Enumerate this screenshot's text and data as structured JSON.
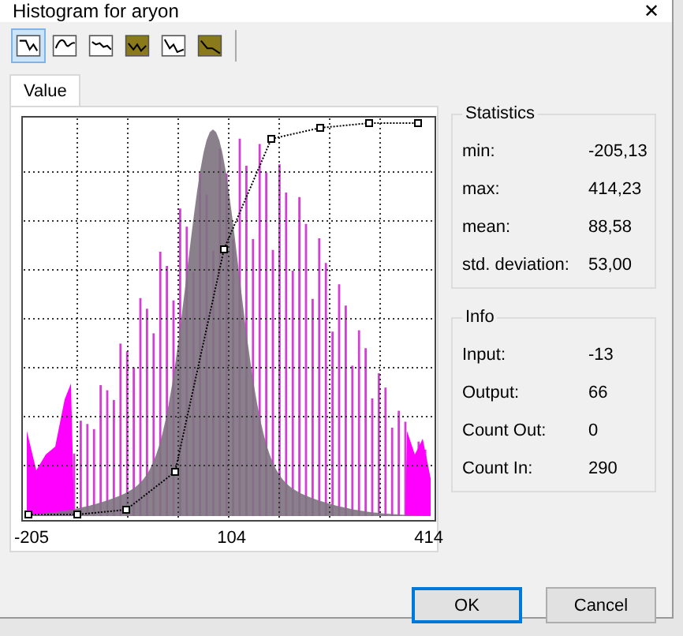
{
  "window": {
    "title": "Histogram for aryon",
    "close": "✕"
  },
  "toolbar": [
    {
      "selected": true
    },
    {
      "selected": false
    },
    {
      "selected": false
    },
    {
      "selected": false
    },
    {
      "selected": false
    },
    {
      "selected": false
    }
  ],
  "tabs": [
    {
      "label": "Value",
      "selected": true
    }
  ],
  "axis_labels": [
    "-205",
    "104",
    "414"
  ],
  "statistics": {
    "title": "Statistics",
    "rows": [
      {
        "label": "min:",
        "value": "-205,13"
      },
      {
        "label": "max:",
        "value": "414,23"
      },
      {
        "label": "mean:",
        "value": "88,58"
      },
      {
        "label": "std. deviation:",
        "value": "53,00"
      }
    ]
  },
  "info": {
    "title": "Info",
    "rows": [
      {
        "label": "Input:",
        "value": "-13"
      },
      {
        "label": "Output:",
        "value": "66"
      },
      {
        "label": "Count Out:",
        "value": "0"
      },
      {
        "label": "Count In:",
        "value": "290"
      }
    ]
  },
  "buttons": [
    {
      "label": "OK",
      "selected": true
    },
    {
      "label": "Cancel",
      "selected": false
    }
  ]
}
